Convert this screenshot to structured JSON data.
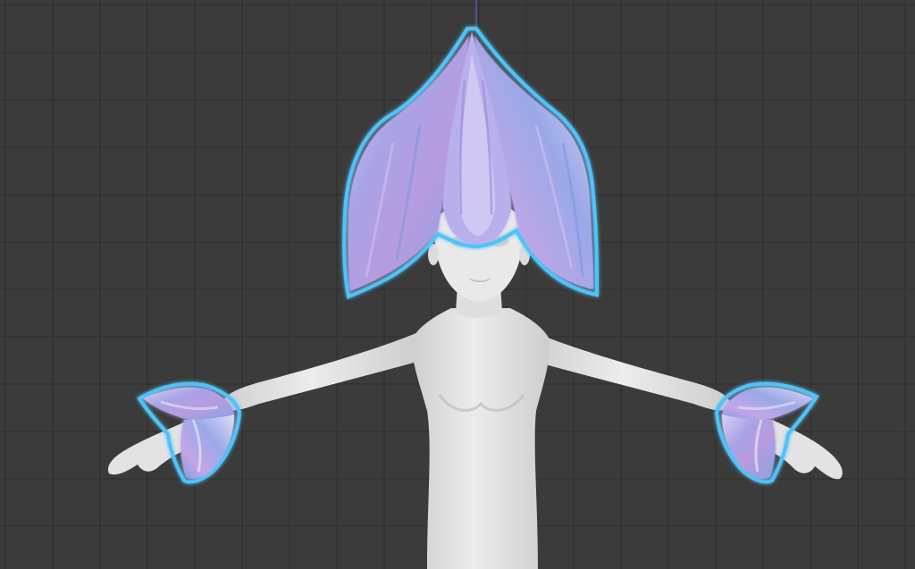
{
  "viewport": {
    "kind": "3d-viewport",
    "background_color": "#3b3b3b",
    "grid_color": "#2c2c2c",
    "grid_visible": true
  },
  "scene": {
    "model_body_color": "#e6e6e6",
    "selection_outline_color": "#4fc3f7",
    "petal_colors": [
      "#8fa8e6",
      "#b49ee0",
      "#d9c8f2"
    ],
    "selected_objects": [
      "flower-hair",
      "left-wrist-flower-cuff",
      "right-wrist-flower-cuff"
    ]
  }
}
